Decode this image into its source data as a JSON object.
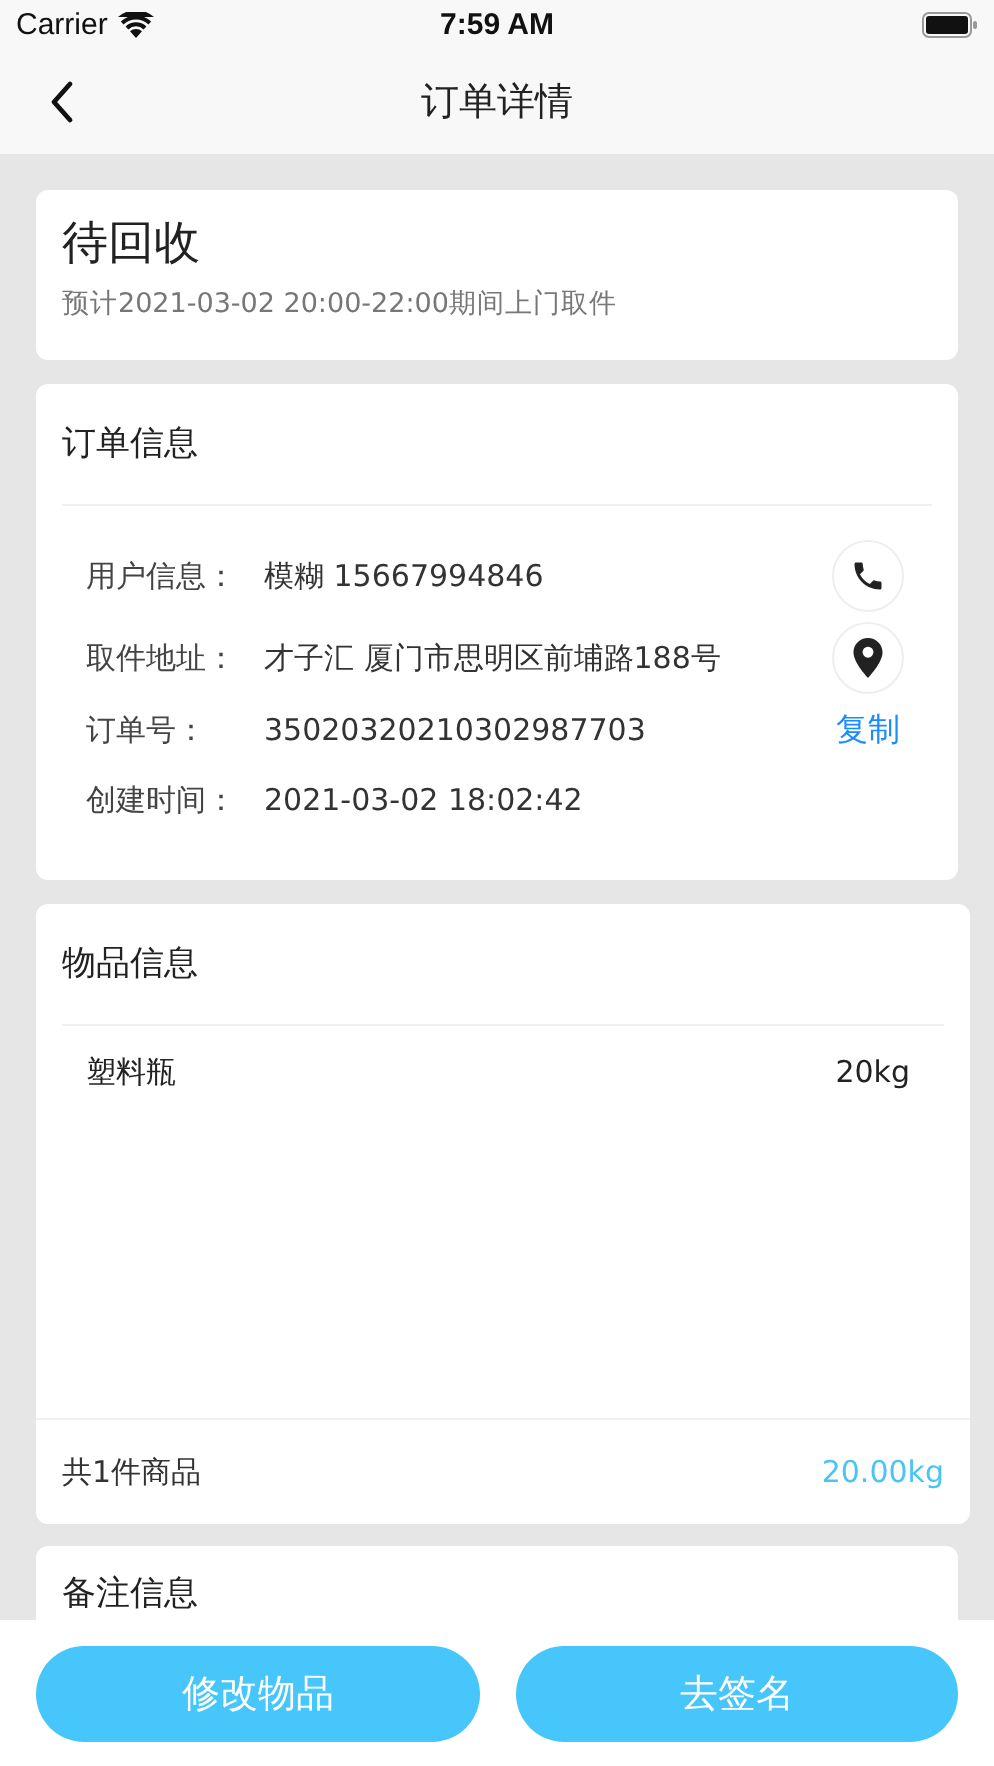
{
  "status_bar": {
    "carrier": "Carrier",
    "time": "7:59 AM"
  },
  "nav": {
    "title": "订单详情"
  },
  "status_card": {
    "status": "待回收",
    "note": "预计2021-03-02 20:00-22:00期间上门取件"
  },
  "order_info": {
    "title": "订单信息",
    "rows": [
      {
        "label": "用户信息：",
        "value": "模糊  15667994846",
        "kind": "call"
      },
      {
        "label": "取件地址：",
        "value": "才子汇 厦门市思明区前埔路188号",
        "kind": "locate"
      },
      {
        "label": "订单号：",
        "value": "35020320210302987703",
        "kind": "copy",
        "action": "复制"
      },
      {
        "label": "创建时间：",
        "value": "2021-03-02 18:02:42",
        "kind": "none"
      }
    ]
  },
  "goods_info": {
    "title": "物品信息",
    "items": [
      {
        "name": "塑料瓶",
        "weight": "20kg"
      }
    ],
    "summary": "共1件商品",
    "total": "20.00kg"
  },
  "remark_info": {
    "title": "备注信息"
  },
  "buttons": [
    "修改物品",
    "去签名"
  ]
}
